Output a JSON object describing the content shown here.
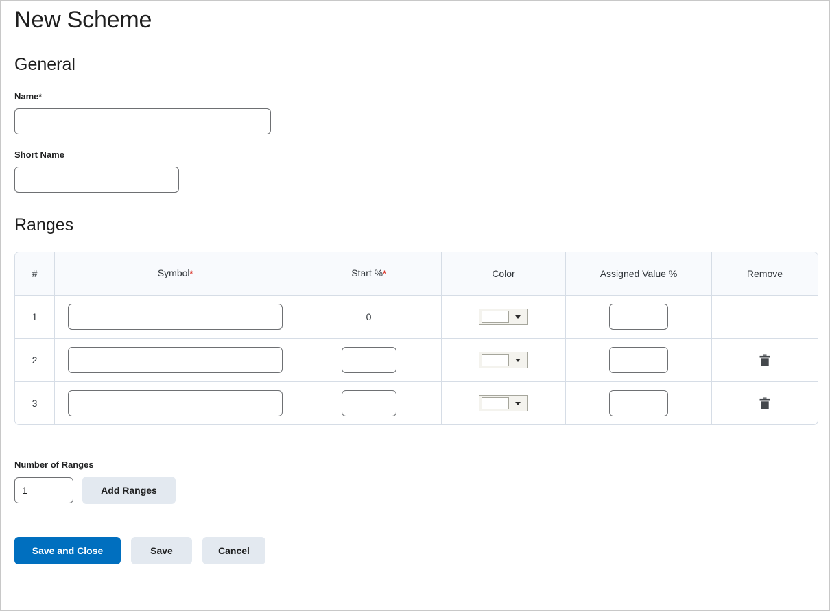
{
  "page": {
    "title": "New Scheme"
  },
  "general": {
    "heading": "General",
    "name": {
      "label": "Name",
      "required_marker": "*",
      "value": "",
      "placeholder": ""
    },
    "short_name": {
      "label": "Short Name",
      "value": "",
      "placeholder": ""
    }
  },
  "ranges": {
    "heading": "Ranges",
    "columns": [
      {
        "label": "#",
        "required_marker": ""
      },
      {
        "label": "Symbol",
        "required_marker": "*"
      },
      {
        "label": "Start %",
        "required_marker": "*"
      },
      {
        "label": "Color",
        "required_marker": ""
      },
      {
        "label": "Assigned Value %",
        "required_marker": ""
      },
      {
        "label": "Remove",
        "required_marker": ""
      }
    ],
    "rows": [
      {
        "number": "1",
        "symbol": "",
        "start_percent": "0",
        "start_is_static": true,
        "color": "#ffffff",
        "assigned_value": "",
        "removable": false,
        "remove_icon": "trash-icon"
      },
      {
        "number": "2",
        "symbol": "",
        "start_percent": "",
        "start_is_static": false,
        "color": "#ffffff",
        "assigned_value": "",
        "removable": true,
        "remove_icon": "trash-icon"
      },
      {
        "number": "3",
        "symbol": "",
        "start_percent": "",
        "start_is_static": false,
        "color": "#ffffff",
        "assigned_value": "",
        "removable": true,
        "remove_icon": "trash-icon"
      }
    ],
    "color_dropdown_icon": "chevron-down-icon",
    "number_of_ranges": {
      "label": "Number of Ranges",
      "value": "1"
    },
    "add_ranges_button": "Add Ranges"
  },
  "actions": {
    "save_and_close": "Save and Close",
    "save": "Save",
    "cancel": "Cancel"
  },
  "colors": {
    "primary": "#006fbf",
    "secondary_button": "#e3e9f0",
    "required_red": "#d93025",
    "table_header_bg": "#f8fafd",
    "table_border": "#d6dde6",
    "input_border": "#6e7073",
    "trash_icon": "#44484c"
  }
}
